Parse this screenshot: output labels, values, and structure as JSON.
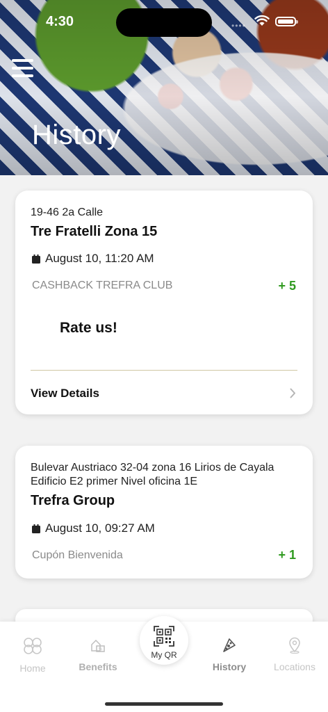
{
  "status_bar": {
    "time": "4:30"
  },
  "header": {
    "title": "History"
  },
  "history": [
    {
      "address": "19-46 2a Calle",
      "restaurant": "Tre Fratelli Zona 15",
      "date": "August 10, 11:20 AM",
      "reward_type": "CASHBACK TREFRA CLUB",
      "points": "+ 5",
      "rate_label": "Rate us!",
      "details_label": "View Details"
    },
    {
      "address": "Bulevar Austriaco 32-04 zona 16 Lirios de Cayala Edificio E2 primer Nivel oficina 1E",
      "restaurant": "Trefra Group",
      "date": "August 10, 09:27 AM",
      "reward_type": "Cupón Bienvenida",
      "points": "+ 1"
    }
  ],
  "tab_bar": {
    "home": "Home",
    "benefits": "Benefits",
    "qr": "My QR",
    "history": "History",
    "locations": "Locations",
    "active": "History"
  },
  "colors": {
    "points": "#2f9a1f",
    "divider": "#cfc7a3"
  },
  "icons": [
    "menu-icon",
    "calendar-icon",
    "chevron-right-icon",
    "home-icon",
    "benefits-icon",
    "qr-code-icon",
    "history-icon",
    "location-pin-icon",
    "wifi-icon",
    "battery-icon"
  ]
}
